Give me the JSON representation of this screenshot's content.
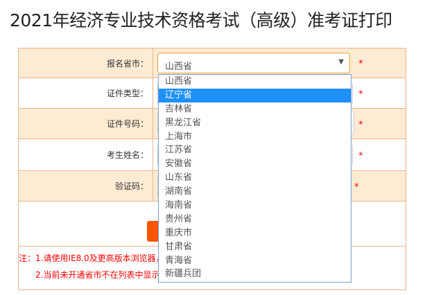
{
  "title": "2021年经济专业技术资格考试（高级）准考证打印",
  "form": {
    "province_label": "报名省市：",
    "province_value": "山西省",
    "id_type_label": "证件类型：",
    "id_number_label": "证件号码：",
    "name_label": "考生姓名：",
    "captcha_label": "验证码：",
    "required_mark": "*"
  },
  "notes": [
    "注：1.请使用IE8.0及更高版本浏览器，",
    "2.当前未开通省市不在列表中显示"
  ],
  "dropdown": {
    "highlighted": "辽宁省",
    "options": [
      "山西省",
      "辽宁省",
      "吉林省",
      "黑龙江省",
      "上海市",
      "江苏省",
      "安徽省",
      "山东省",
      "湖南省",
      "海南省",
      "贵州省",
      "重庆市",
      "甘肃省",
      "青海省",
      "新疆兵团"
    ]
  },
  "colors": {
    "accent": "#ff5500",
    "row_bg": "#fdebd3",
    "highlight": "#1e90ff"
  }
}
